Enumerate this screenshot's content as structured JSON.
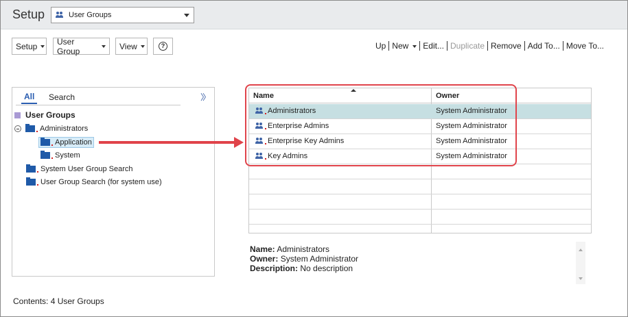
{
  "header": {
    "title": "Setup",
    "selector_value": "User Groups"
  },
  "toolbar": {
    "setup_label": "Setup",
    "usergroup_label": "User Group",
    "view_label": "View",
    "help_label": "?"
  },
  "actions": {
    "up": "Up",
    "new": "New",
    "edit": "Edit...",
    "duplicate": "Duplicate",
    "remove": "Remove",
    "add_to": "Add To...",
    "move_to": "Move To..."
  },
  "tabs": {
    "all": "All",
    "search": "Search"
  },
  "tree": {
    "root": "User Groups",
    "administrators": "Administrators",
    "application": "Application",
    "system": "System",
    "system_user_group_search": "System User Group Search",
    "user_group_search": "User Group Search (for system use)"
  },
  "grid": {
    "col_name": "Name",
    "col_owner": "Owner",
    "rows": [
      {
        "name": "Administrators",
        "owner": "System Administrator"
      },
      {
        "name": "Enterprise Admins",
        "owner": "System Administrator"
      },
      {
        "name": "Enterprise Key Admins",
        "owner": "System Administrator"
      },
      {
        "name": "Key Admins",
        "owner": "System Administrator"
      }
    ]
  },
  "details": {
    "name_label": "Name:",
    "name_value": "Administrators",
    "owner_label": "Owner:",
    "owner_value": "System Administrator",
    "description_label": "Description:",
    "description_value": "No description"
  },
  "status": {
    "contents": "Contents: 4 User Groups"
  },
  "colors": {
    "accent_blue": "#2a5db0",
    "folder_blue": "#1f5aa8",
    "highlight_red": "#e0434a",
    "selected_row": "#c6dfe2"
  }
}
